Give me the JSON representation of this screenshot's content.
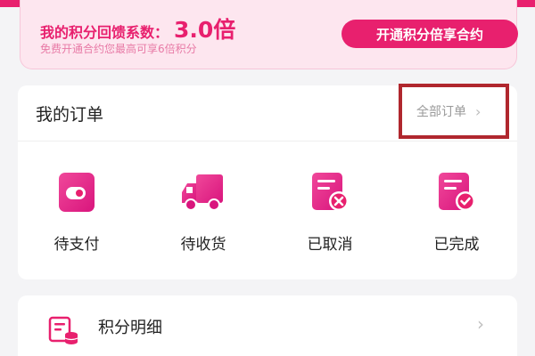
{
  "points": {
    "title_prefix": "我的积分回馈系数：",
    "multiplier": "3.0倍",
    "subtitle": "免费开通合约您最高可享6倍积分",
    "button_label": "开通积分倍享合约"
  },
  "orders": {
    "title": "我的订单",
    "all_orders_label": "全部订单",
    "chevron": "›",
    "items": [
      {
        "label": "待支付",
        "icon": "wallet-icon"
      },
      {
        "label": "待收货",
        "icon": "truck-icon"
      },
      {
        "label": "已取消",
        "icon": "doc-cancel-icon"
      },
      {
        "label": "已完成",
        "icon": "doc-check-icon"
      }
    ]
  },
  "points_detail": {
    "label": "积分明细",
    "icon": "ledger-coins-icon",
    "chevron": "›"
  },
  "colors": {
    "brand": "#e8206e",
    "card_bg": "#fde6ef",
    "highlight_border": "#b0272e"
  }
}
